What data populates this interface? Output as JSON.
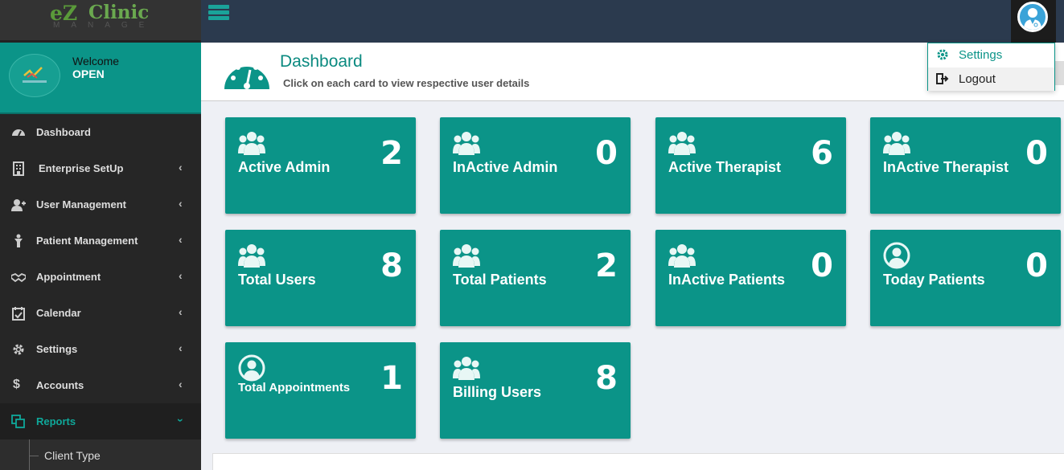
{
  "app": {
    "logo_ez": "eZ",
    "logo_clinic": "Clinic",
    "logo_sub": "MANAGE"
  },
  "welcome": {
    "label": "Welcome",
    "name": "OPEN"
  },
  "sidebar": {
    "items": [
      {
        "label": "Dashboard",
        "icon": "dashboard-icon"
      },
      {
        "label": "Enterprise SetUp",
        "icon": "building-icon"
      },
      {
        "label": "User Management",
        "icon": "user-plus-icon"
      },
      {
        "label": "Patient Management",
        "icon": "patient-icon"
      },
      {
        "label": "Appointment",
        "icon": "handshake-icon"
      },
      {
        "label": "Calendar",
        "icon": "calendar-check-icon"
      },
      {
        "label": "Settings",
        "icon": "cog-icon"
      },
      {
        "label": "Accounts",
        "icon": "dollar-icon"
      },
      {
        "label": "Reports",
        "icon": "copy-icon"
      }
    ],
    "sub_items": [
      {
        "label": "Client Type"
      }
    ]
  },
  "header": {
    "title": "Dashboard",
    "subtitle": "Click on each card to view respective user details"
  },
  "user_menu": {
    "settings_label": "Settings",
    "logout_label": "Logout"
  },
  "cards": [
    {
      "label": "Active Admin",
      "count": "2",
      "icon": "users-icon"
    },
    {
      "label": "InActive Admin",
      "count": "0",
      "icon": "users-icon"
    },
    {
      "label": "Active Therapist",
      "count": "6",
      "icon": "users-icon"
    },
    {
      "label": "InActive Therapist",
      "count": "0",
      "icon": "users-icon"
    },
    {
      "label": "Total Users",
      "count": "8",
      "icon": "users-icon"
    },
    {
      "label": "Total Patients",
      "count": "2",
      "icon": "users-icon"
    },
    {
      "label": "InActive Patients",
      "count": "0",
      "icon": "users-icon"
    },
    {
      "label": "Today Patients",
      "count": "0",
      "icon": "user-circle-icon"
    },
    {
      "label": "Total Appointments",
      "count": "1",
      "icon": "user-circle-icon"
    },
    {
      "label": "Billing Users",
      "count": "8",
      "icon": "users-icon"
    }
  ],
  "colors": {
    "teal": "#0b9488",
    "topbar": "#2b3a4e",
    "sidebar": "#262626"
  }
}
